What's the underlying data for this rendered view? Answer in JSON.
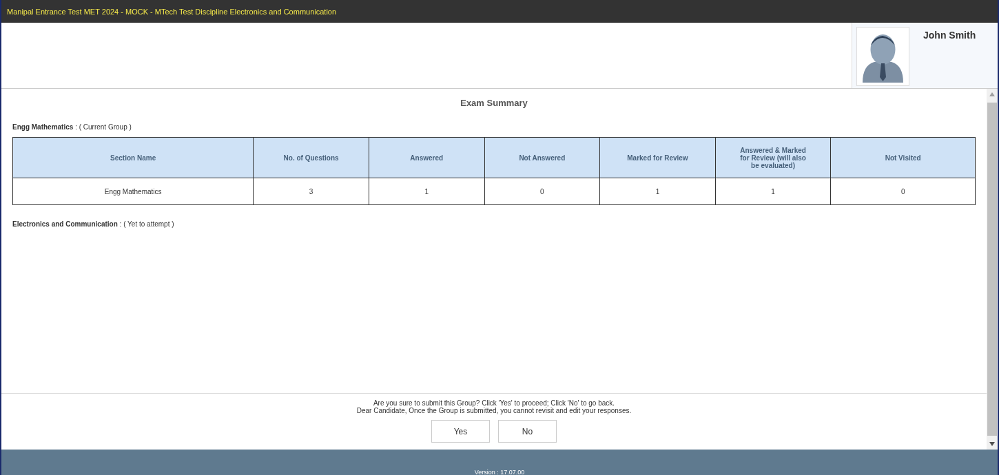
{
  "window": {
    "title": "Manipal Entrance Test MET 2024 - MOCK - MTech Test Discipline Electronics and Communication"
  },
  "candidate": {
    "name": "John Smith"
  },
  "summary": {
    "title": "Exam Summary",
    "groups": [
      {
        "name": "Engg Mathematics",
        "status": ": ( Current Group )",
        "table": {
          "columns": [
            "Section Name",
            "No. of Questions",
            "Answered",
            "Not Answered",
            "Marked for Review",
            "Answered & Marked for Review (will also be evaluated)",
            "Not Visited"
          ],
          "rows": [
            [
              "Engg Mathematics",
              "3",
              "1",
              "0",
              "1",
              "1",
              "0"
            ]
          ]
        }
      },
      {
        "name": "Electronics and Communication",
        "status": ": ( Yet to attempt )"
      }
    ]
  },
  "confirm": {
    "lines": [
      "Are you sure to submit this Group? Click 'Yes' to proceed; Click 'No' to go back.",
      "Dear Candidate, Once the Group is submitted, you cannot revisit and edit your responses."
    ],
    "buttons": [
      "Yes",
      "No"
    ]
  },
  "status_bar": {
    "version": "Version : 17.07.00"
  }
}
